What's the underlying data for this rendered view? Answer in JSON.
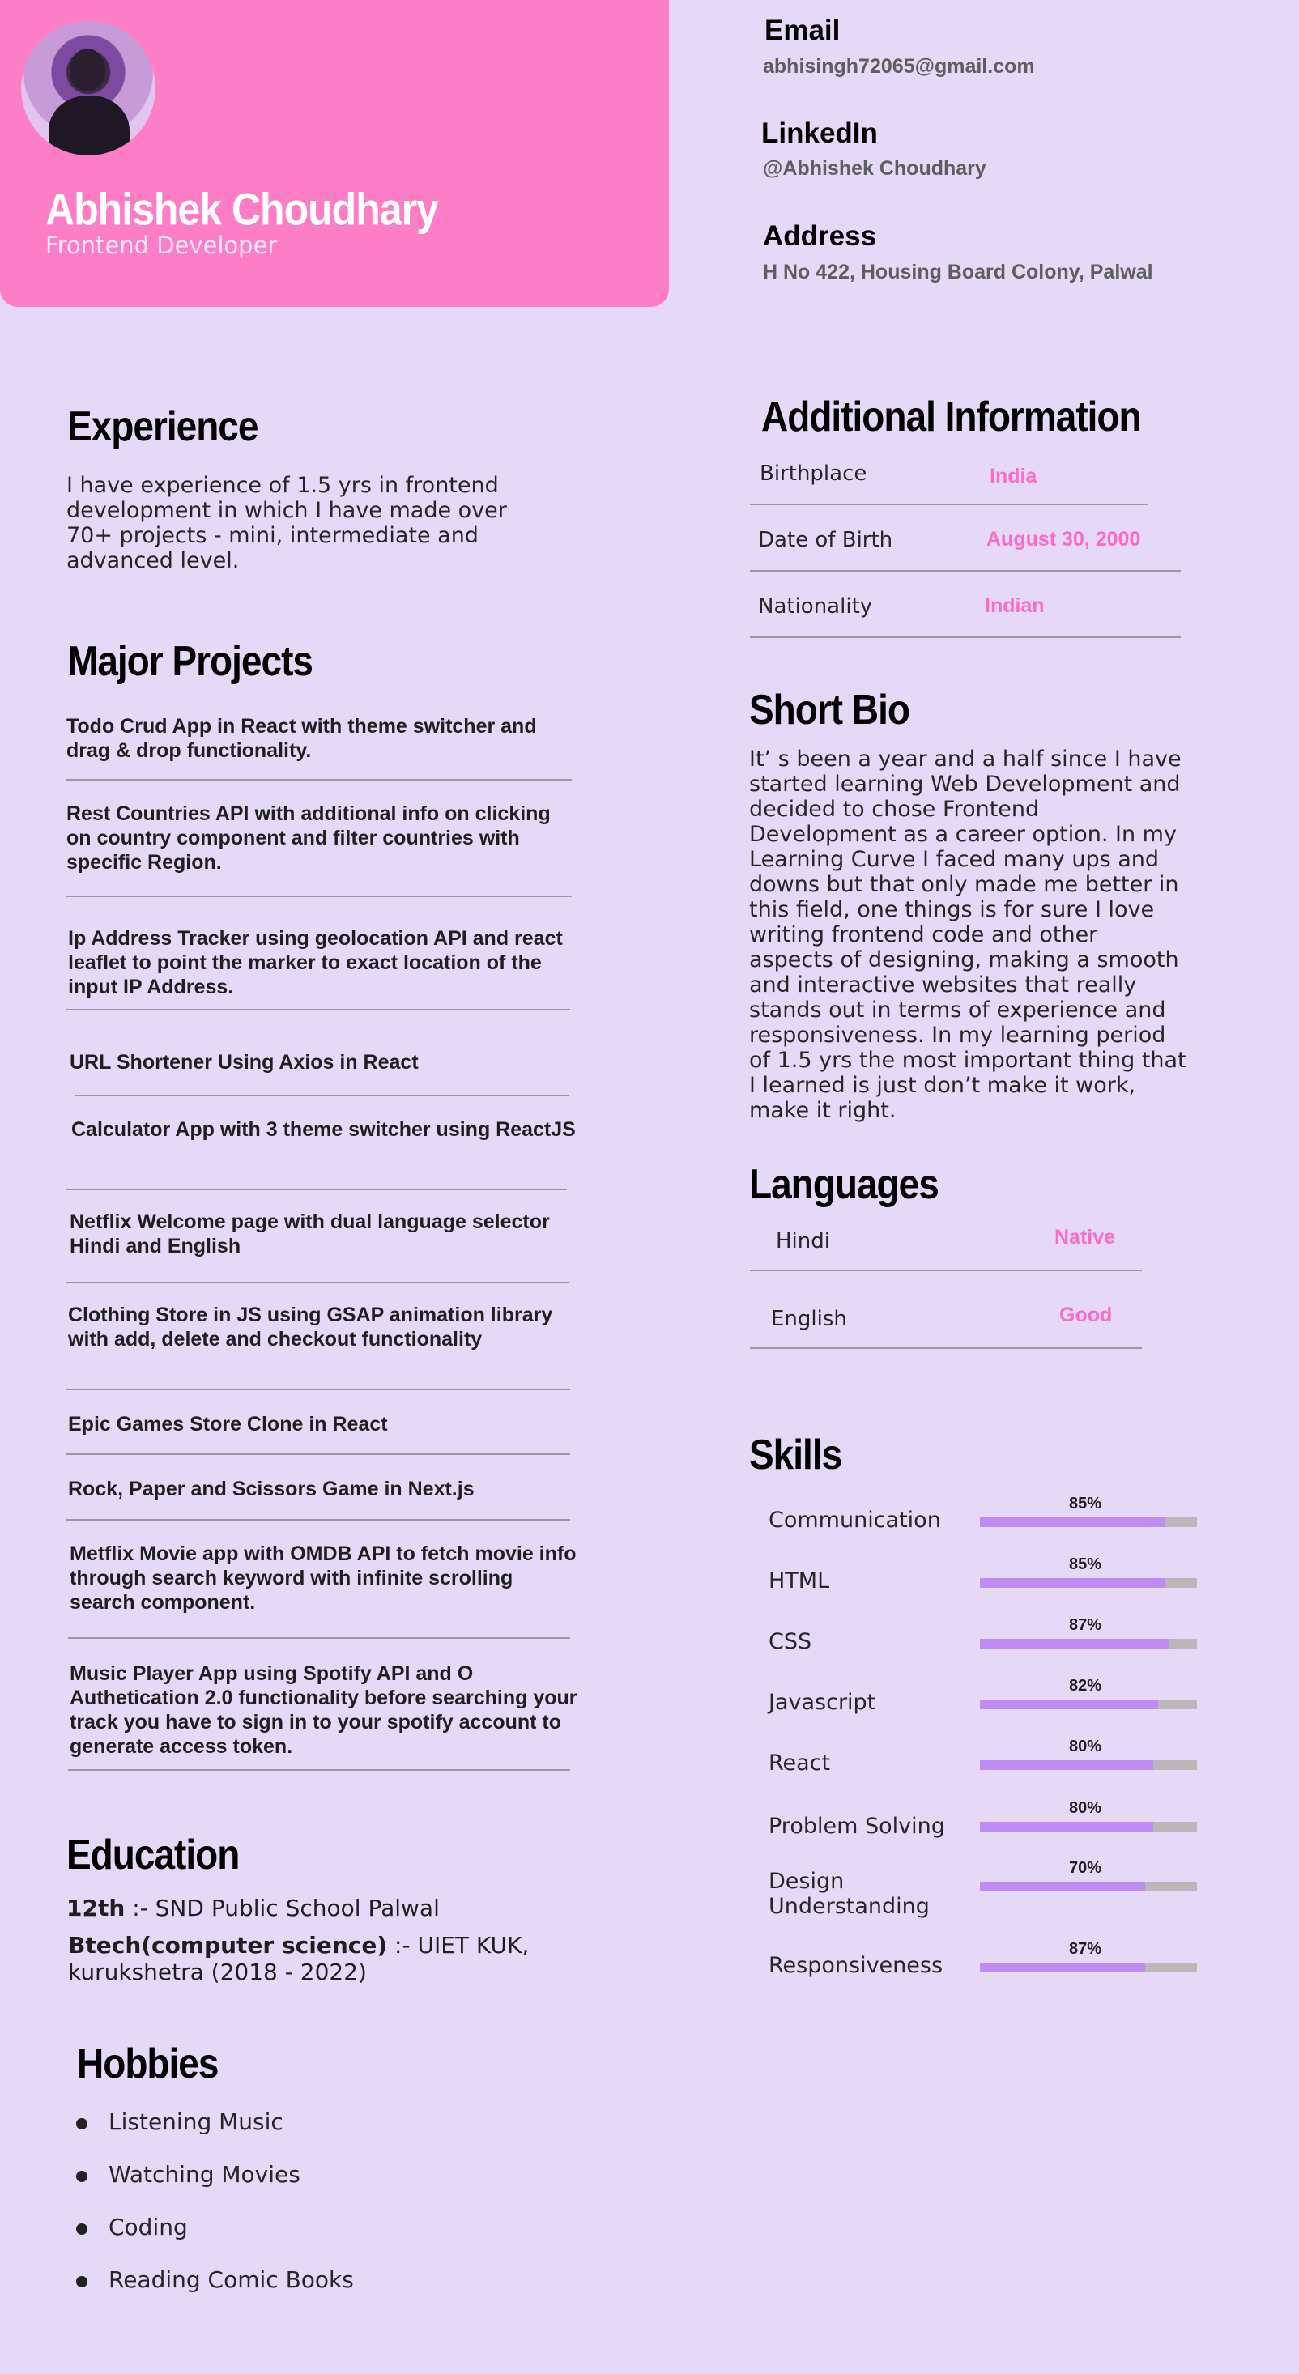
{
  "profile": {
    "name": "Abhishek Choudhary",
    "role": "Frontend Developer"
  },
  "contact": {
    "email_label": "Email",
    "email": "abhisingh72065@gmail.com",
    "linkedin_label": "LinkedIn",
    "linkedin": "@Abhishek Choudhary",
    "address_label": "Address",
    "address": "H No 422, Housing Board Colony, Palwal"
  },
  "experience": {
    "title": "Experience",
    "text": "I have experience of 1.5 yrs in frontend development in which I have made over 70+ projects - mini, intermediate  and advanced level."
  },
  "projects": {
    "title": "Major Projects",
    "items": [
      "Todo  Crud App in React with theme switcher and drag & drop functionality.",
      "Rest Countries API with additional info on clicking on country component and filter countries with specific Region.",
      "Ip Address Tracker using geolocation API and react leaflet to point the marker to exact location of the input IP Address.",
      "URL Shortener Using Axios in React",
      "Calculator App with 3 theme switcher using ReactJS",
      "Netflix Welcome page with dual language selector Hindi and English",
      "Clothing Store in  JS using GSAP animation library with add, delete and checkout functionality",
      "Epic Games Store Clone in React",
      "Rock, Paper and Scissors Game in Next.js",
      "Metflix Movie app with OMDB API to fetch movie info through search keyword with infinite scrolling search component.",
      "Music Player App using Spotify API and O Authetication 2.0 functionality before searching your track you have to sign in to your spotify account to generate access token."
    ]
  },
  "education": {
    "title": "Education",
    "school_label": "12th",
    "school": ":- SND Public School Palwal",
    "college_label": "Btech(computer science)",
    "college": ":- UIET KUK, kurukshetra (2018 - 2022)"
  },
  "hobbies": {
    "title": "Hobbies",
    "items": [
      "Listening Music",
      "Watching Movies",
      "Coding",
      "Reading Comic Books"
    ]
  },
  "additional_info": {
    "title": "Additional Information",
    "rows": [
      {
        "key": "Birthplace",
        "value": "India"
      },
      {
        "key": "Date of Birth",
        "value": "August 30, 2000"
      },
      {
        "key": "Nationality",
        "value": "Indian"
      }
    ]
  },
  "bio": {
    "title": "Short Bio",
    "text": "It’ s been a year and a half since I have started learning Web Development and decided to chose Frontend Development as a career option. In my Learning Curve I faced many ups and downs but that only made me better in this field, one things is for sure I love writing frontend code and other aspects of designing, making a smooth and interactive websites that really stands out in terms of experience and responsiveness. In my learning period of 1.5 yrs the most important thing that I learned is just don’t make it work, make it right."
  },
  "languages": {
    "title": "Languages",
    "items": [
      {
        "name": "Hindi",
        "level": "Native"
      },
      {
        "name": "English",
        "level": "Good"
      }
    ]
  },
  "skills": {
    "title": "Skills",
    "items": [
      {
        "name": "Communication",
        "pct_label": "85%",
        "fill": 0.85
      },
      {
        "name": "HTML",
        "pct_label": "85%",
        "fill": 0.85
      },
      {
        "name": "CSS",
        "pct_label": "87%",
        "fill": 0.87
      },
      {
        "name": "Javascript",
        "pct_label": "82%",
        "fill": 0.82
      },
      {
        "name": "React",
        "pct_label": "80%",
        "fill": 0.8
      },
      {
        "name": "Problem Solving",
        "pct_label": "80%",
        "fill": 0.8
      },
      {
        "name": "Design Understanding",
        "pct_label": "70%",
        "fill": 0.76
      },
      {
        "name": "Responsiveness",
        "pct_label": "87%",
        "fill": 0.76
      }
    ]
  },
  "colors": {
    "page_bg": "#e6d9f8",
    "header_bg": "#fd7dc6",
    "accent_pink": "#fb6cc6",
    "bar_fill": "#bf8bf5",
    "bar_track": "#bcb6bb"
  }
}
